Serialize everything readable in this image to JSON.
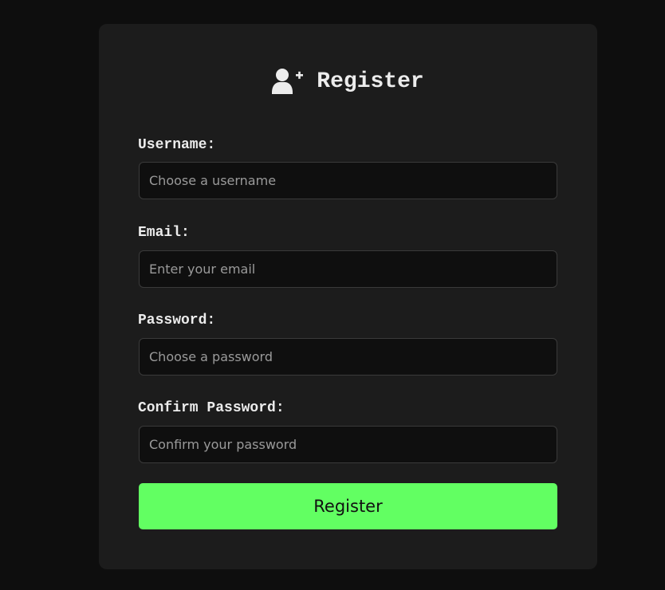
{
  "form": {
    "title": "Register",
    "title_icon": "user-plus-icon",
    "fields": [
      {
        "label": "Username:",
        "placeholder": "Choose a username",
        "value": ""
      },
      {
        "label": "Email:",
        "placeholder": "Enter your email",
        "value": ""
      },
      {
        "label": "Password:",
        "placeholder": "Choose a password",
        "value": ""
      },
      {
        "label": "Confirm Password:",
        "placeholder": "Confirm your password",
        "value": ""
      }
    ],
    "submit_label": "Register"
  },
  "colors": {
    "page_background": "#0e0e0e",
    "card_background": "#1c1c1c",
    "input_background": "#0f0f0f",
    "accent": "#62ff62",
    "text": "#ececec"
  }
}
